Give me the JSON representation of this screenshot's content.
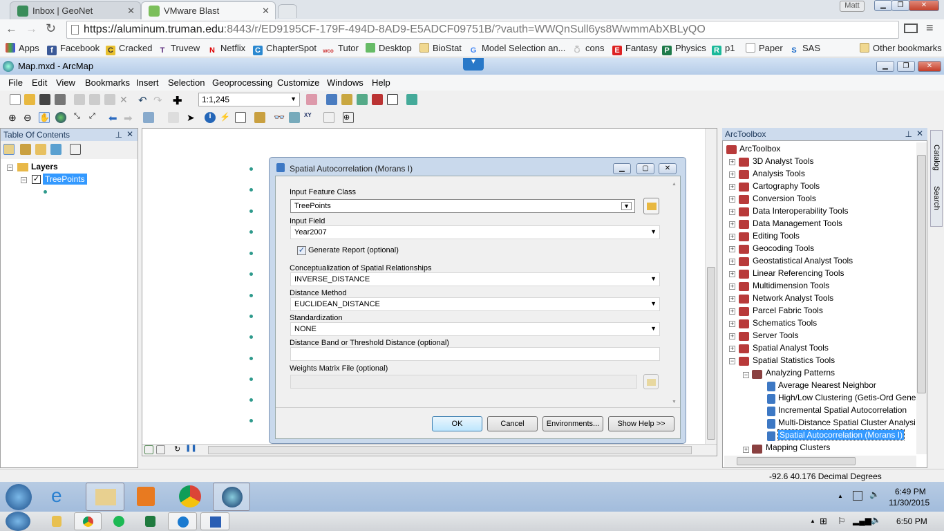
{
  "browser": {
    "tabs": [
      {
        "label": "Inbox | GeoNet"
      },
      {
        "label": "VMware Blast"
      }
    ],
    "user": "Matt",
    "url_host": "https://aluminum.truman.edu",
    "url_rest": ":8443/r/ED9195CF-179F-494D-8AD9-E5ADCF09751B/?vauth=WWQnSull6ys8WwmmAbXBLyQO",
    "bookmarks": [
      "Apps",
      "Facebook",
      "Cracked",
      "Truvew",
      "Netflix",
      "ChapterSpot",
      "Tutor",
      "Desktop",
      "BioStat",
      "Model Selection an...",
      "cons",
      "Fantasy",
      "Physics",
      "p1",
      "Paper",
      "SAS"
    ],
    "other_bookmarks": "Other bookmarks"
  },
  "arcmap": {
    "title": "Map.mxd - ArcMap",
    "menu": [
      "File",
      "Edit",
      "View",
      "Bookmarks",
      "Insert",
      "Selection",
      "Geoprocessing",
      "Customize",
      "Windows",
      "Help"
    ],
    "scale": "1:1,245"
  },
  "toc": {
    "title": "Table Of Contents",
    "layers": "Layers",
    "layer": "TreePoints"
  },
  "dialog": {
    "title": "Spatial Autocorrelation (Morans I)",
    "input_feature_class_label": "Input Feature Class",
    "input_feature_class": "TreePoints",
    "input_field_label": "Input Field",
    "input_field": "Year2007",
    "generate_report": "Generate Report (optional)",
    "generate_report_checked": true,
    "concept_label": "Conceptualization of Spatial Relationships",
    "concept": "INVERSE_DISTANCE",
    "distance_method_label": "Distance Method",
    "distance_method": "EUCLIDEAN_DISTANCE",
    "standardization_label": "Standardization",
    "standardization": "NONE",
    "distance_band_label": "Distance Band or Threshold Distance (optional)",
    "distance_band": "",
    "weights_label": "Weights Matrix File (optional)",
    "weights": "",
    "ok": "OK",
    "cancel": "Cancel",
    "environments": "Environments...",
    "show_help": "Show Help >>"
  },
  "toolbox": {
    "title": "ArcToolbox",
    "root": "ArcToolbox",
    "items": [
      "3D Analyst Tools",
      "Analysis Tools",
      "Cartography Tools",
      "Conversion Tools",
      "Data Interoperability Tools",
      "Data Management Tools",
      "Editing Tools",
      "Geocoding Tools",
      "Geostatistical Analyst Tools",
      "Linear Referencing Tools",
      "Multidimension Tools",
      "Network Analyst Tools",
      "Parcel Fabric Tools",
      "Schematics Tools",
      "Server Tools",
      "Spatial Analyst Tools",
      "Spatial Statistics Tools"
    ],
    "sub": "Analyzing Patterns",
    "tools": [
      "Average Nearest Neighbor",
      "High/Low Clustering (Getis-Ord Gene",
      "Incremental Spatial Autocorrelation",
      "Multi-Distance Spatial Cluster Analysi",
      "Spatial Autocorrelation (Morans I)"
    ],
    "next": "Mapping Clusters",
    "side_tabs": [
      "Catalog",
      "Search"
    ]
  },
  "status": {
    "coords": "-92.6  40.176 Decimal Degrees"
  },
  "taskbar": {
    "time1": "6:49 PM",
    "date1": "11/30/2015",
    "time2": "6:50 PM"
  }
}
